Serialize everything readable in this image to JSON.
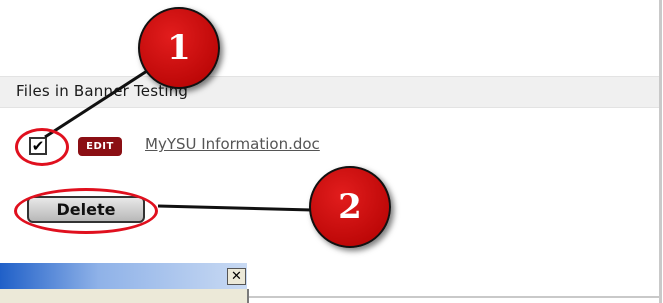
{
  "panel": {
    "header_title": "Files in Banner Testing"
  },
  "file_row": {
    "checkbox_checked": true,
    "checkbox_mark": "✔",
    "edit_badge": "EDIT",
    "file_name": "MyYSU Information.doc"
  },
  "actions": {
    "delete_label": "Delete"
  },
  "callouts": {
    "one": "1",
    "two": "2"
  },
  "dialog": {
    "close_glyph": "✕"
  },
  "colors": {
    "highlight": "#e0101e",
    "callout": "#c40000",
    "edit_badge": "#8b0f14",
    "dialog_title": "#2060c8"
  }
}
